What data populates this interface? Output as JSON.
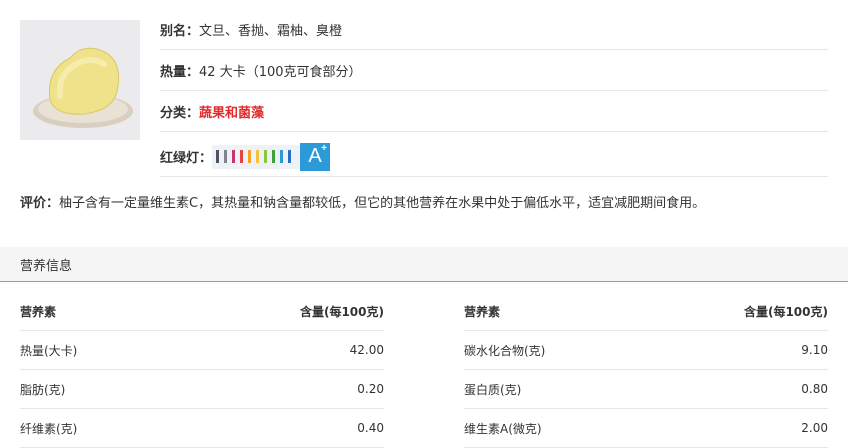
{
  "info": {
    "alias_label": "别名：",
    "alias_value": "文旦、香抛、霜柚、臭橙",
    "calorie_label": "热量：",
    "calorie_value": "42 大卡（100克可食部分）",
    "category_label": "分类：",
    "category_value": "蔬果和菌藻",
    "traffic_label": "红绿灯：",
    "grade_letter": "A",
    "grade_plus": "+",
    "grade_color": "#2d9ad8"
  },
  "comment": {
    "label": "评价：",
    "text": "柚子含有一定量维生素C，其热量和钠含量都较低，但它的其他营养在水果中处于偏低水平，适宜减肥期间食用。"
  },
  "nutrition": {
    "section_title": "营养信息",
    "header_name": "营养素",
    "header_amount": "含量(每100克)",
    "left": [
      {
        "name": "热量(大卡)",
        "value": "42.00"
      },
      {
        "name": "脂肪(克)",
        "value": "0.20"
      },
      {
        "name": "纤维素(克)",
        "value": "0.40"
      }
    ],
    "right": [
      {
        "name": "碳水化合物(克)",
        "value": "9.10"
      },
      {
        "name": "蛋白质(克)",
        "value": "0.80"
      },
      {
        "name": "维生素A(微克)",
        "value": "2.00"
      }
    ]
  }
}
